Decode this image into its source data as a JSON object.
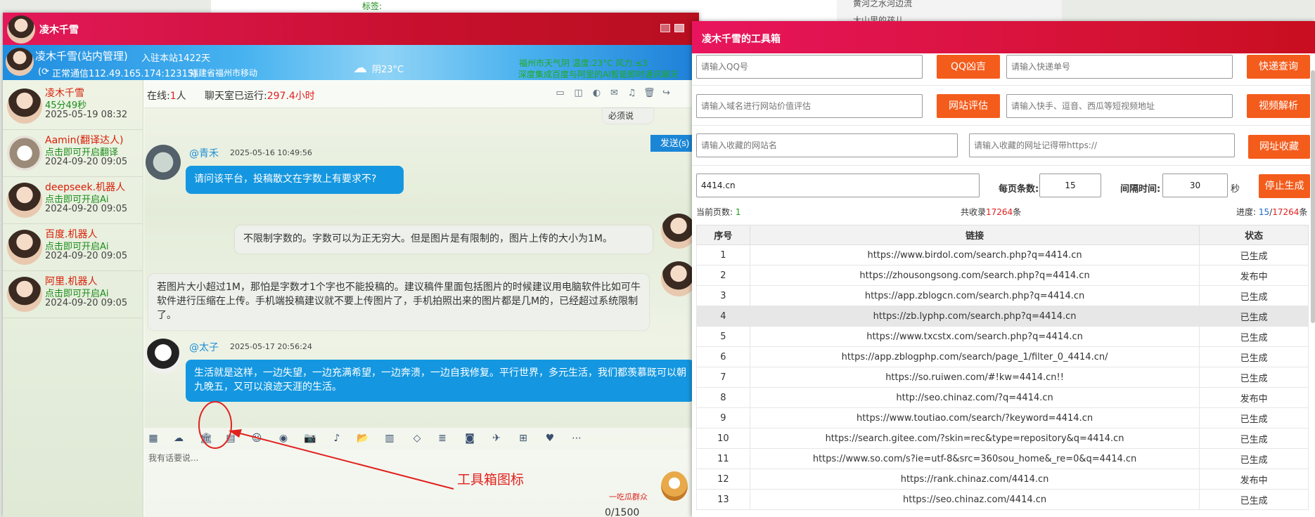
{
  "background": {
    "bg_label_tag": "标签:",
    "bg_items": [
      "黄河之水河边流",
      "大山里的孩儿"
    ]
  },
  "chat": {
    "title": "凌木千雪",
    "banner": {
      "user": "凌木千雪(站内管理)",
      "join_info": "入驻本站1422天",
      "connection": "正常通信112.49.165.174:12315)",
      "location": "福建省福州市移动",
      "weather": "阴23°C",
      "ticker_line1": "福州市天气阴 温度:23°C 风力:≤3",
      "ticker_line2": "深度集成百度与阿里的AI智能即时通讯聊天"
    },
    "contacts": [
      {
        "name": "凌木千雪",
        "status": "45分49秒",
        "time": "2025-05-19 08:32"
      },
      {
        "name": "Aamin(翻译达人)",
        "status": "点击即可开启翻译",
        "time": "2024-09-20 09:05"
      },
      {
        "name": "deepseek.机器人",
        "status": "点击即可开启Ai",
        "time": "2024-09-20 09:05"
      },
      {
        "name": "百度.机器人",
        "status": "点击即可开启Ai",
        "time": "2024-09-20 09:05"
      },
      {
        "name": "阿里.机器人",
        "status": "点击即可开启Ai",
        "time": "2024-09-20 09:05"
      }
    ],
    "stats": {
      "online_label": "在线:",
      "online_count": "1",
      "online_unit": "人",
      "uptime_label": "聊天室已运行:",
      "uptime_value": "297.4小时"
    },
    "partial_top_text": "必须说",
    "messages": [
      {
        "name": "@青禾",
        "time": "2025-05-16 10:49:56",
        "text": "请问该平台，投稿散文在字数上有要求不?"
      },
      {
        "text": "不限制字数的。字数可以为正无穷大。但是图片是有限制的，图片上传的大小为1M。"
      },
      {
        "text": "若图片大小超过1M，那怕是字数才1个字也不能投稿的。建议稿件里面包括图片的时候建议用电脑软件比如可牛软件进行压缩在上传。手机端投稿建议就不要上传图片了，手机拍照出来的图片都是几M的，已经超过系统限制了。"
      },
      {
        "name": "@太子",
        "time": "2025-05-17 20:56:24",
        "text": "生活就是这样，一边失望，一边充满希望，一边奔溃，一边自我修复。平行世界，多元生活，我们都羡慕既可以朝九晚五，又可以浪迹天涯的生活。"
      }
    ],
    "input_placeholder": "我有话要说...",
    "counter": "0/1500",
    "send_label": "发送(s)",
    "sticker_text": "一吃瓜群众"
  },
  "annotation": {
    "text": "工具箱图标"
  },
  "toolbox": {
    "title": "凌木千雪的工具箱",
    "qq_placeholder": "请输入QQ号",
    "qq_button": "QQ凶吉",
    "express_placeholder": "请输入快递单号",
    "express_button": "快递查询",
    "domain_placeholder": "请输入域名进行网站价值评估",
    "domain_button": "网站评估",
    "video_placeholder": "请输入快手、逗音、西瓜等短视频地址",
    "video_button": "视频解析",
    "fav_name_placeholder": "请输入收藏的网站名",
    "fav_url_placeholder": "请输入收藏的网址记得带https://",
    "fav_button": "网址收藏",
    "gen_domain": "4414.cn",
    "per_page_label": "每页条数:",
    "per_page": "15",
    "interval_label": "间隔时间:",
    "interval": "30",
    "interval_unit": "秒",
    "stop_button": "停止生成",
    "current_page_label": "当前页数:",
    "current_page": "1",
    "total_prefix": "共收录",
    "total_count": "17264",
    "total_suffix": "条",
    "progress_label": "进度:",
    "progress_done": "15",
    "progress_sep": "/",
    "progress_total": "17264",
    "progress_suffix": "条",
    "columns": [
      "序号",
      "链接",
      "状态"
    ],
    "rows": [
      {
        "id": "1",
        "url": "https://www.birdol.com/search.php?q=4414.cn",
        "status": "已生成",
        "kind": "done"
      },
      {
        "id": "2",
        "url": "https://zhousongsong.com/search.php?q=4414.cn",
        "status": "发布中",
        "kind": "pub"
      },
      {
        "id": "3",
        "url": "https://app.zblogcn.com/search.php?q=4414.cn",
        "status": "已生成",
        "kind": "done"
      },
      {
        "id": "4",
        "url": "https://zb.lyphp.com/search.php?q=4414.cn",
        "status": "已生成",
        "kind": "done"
      },
      {
        "id": "5",
        "url": "https://www.txcstx.com/search.php?q=4414.cn",
        "status": "已生成",
        "kind": "done"
      },
      {
        "id": "6",
        "url": "https://app.zblogphp.com/search/page_1/filter_0_4414.cn/",
        "status": "已生成",
        "kind": "done"
      },
      {
        "id": "7",
        "url": "https://so.ruiwen.com/#!kw=4414.cn!!",
        "status": "已生成",
        "kind": "done"
      },
      {
        "id": "8",
        "url": "http://seo.chinaz.com/?q=4414.cn",
        "status": "发布中",
        "kind": "pub"
      },
      {
        "id": "9",
        "url": "https://www.toutiao.com/search/?keyword=4414.cn",
        "status": "已生成",
        "kind": "done"
      },
      {
        "id": "10",
        "url": "https://search.gitee.com/?skin=rec&type=repository&q=4414.cn",
        "status": "已生成",
        "kind": "done"
      },
      {
        "id": "11",
        "url": "https://www.so.com/s?ie=utf-8&src=360sou_home&_re=0&q=4414.cn",
        "status": "已生成",
        "kind": "done"
      },
      {
        "id": "12",
        "url": "https://rank.chinaz.com/4414.cn",
        "status": "发布中",
        "kind": "pub"
      },
      {
        "id": "13",
        "url": "https://seo.chinaz.com/4414.cn",
        "status": "已生成",
        "kind": "done"
      }
    ]
  },
  "colors": {
    "accent_red": "#d41232",
    "chat_blue": "#1497e0",
    "button_orange": "#f45c1c",
    "status_done": "#1a9b1a",
    "status_pub": "#ee8a00"
  }
}
